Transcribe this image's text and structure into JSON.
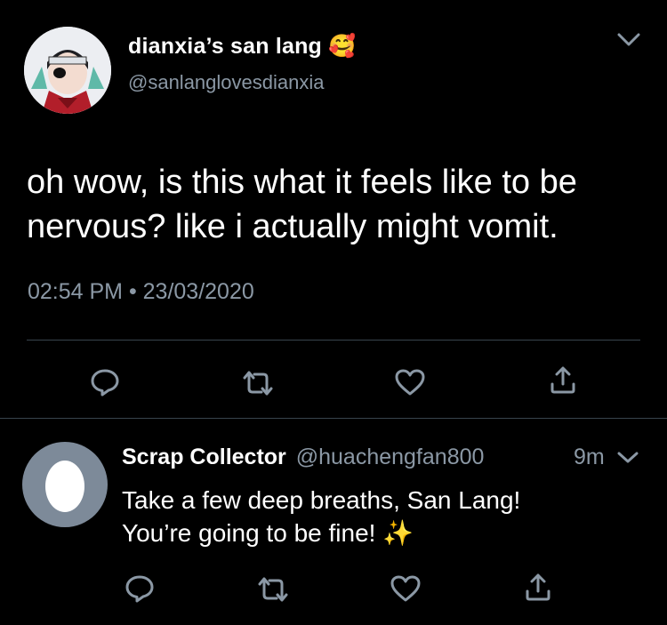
{
  "tweet": {
    "display_name": "dianxia’s san lang",
    "name_emoji": "🥰",
    "handle": "@sanlanglovesdianxia",
    "text_line1": "oh wow, is this what it feels like to be",
    "text_line2": "nervous? like i actually might vomit.",
    "timestamp": "02:54 PM • 23/03/2020"
  },
  "reply": {
    "display_name": "Scrap Collector",
    "handle": "@huachengfan800",
    "time": "9m",
    "text_line1": "Take a few deep breaths, San Lang!",
    "text_line2": "You’re going to be fine!",
    "text_emoji": "✨"
  },
  "colors": {
    "background": "#000000",
    "text": "#ffffff",
    "muted": "#8b98a5",
    "divider": "#38444d",
    "egg_avatar_bg": "#7d8a99"
  },
  "icons": [
    "chevron-down-icon",
    "reply-icon",
    "retweet-icon",
    "like-icon",
    "share-icon"
  ]
}
